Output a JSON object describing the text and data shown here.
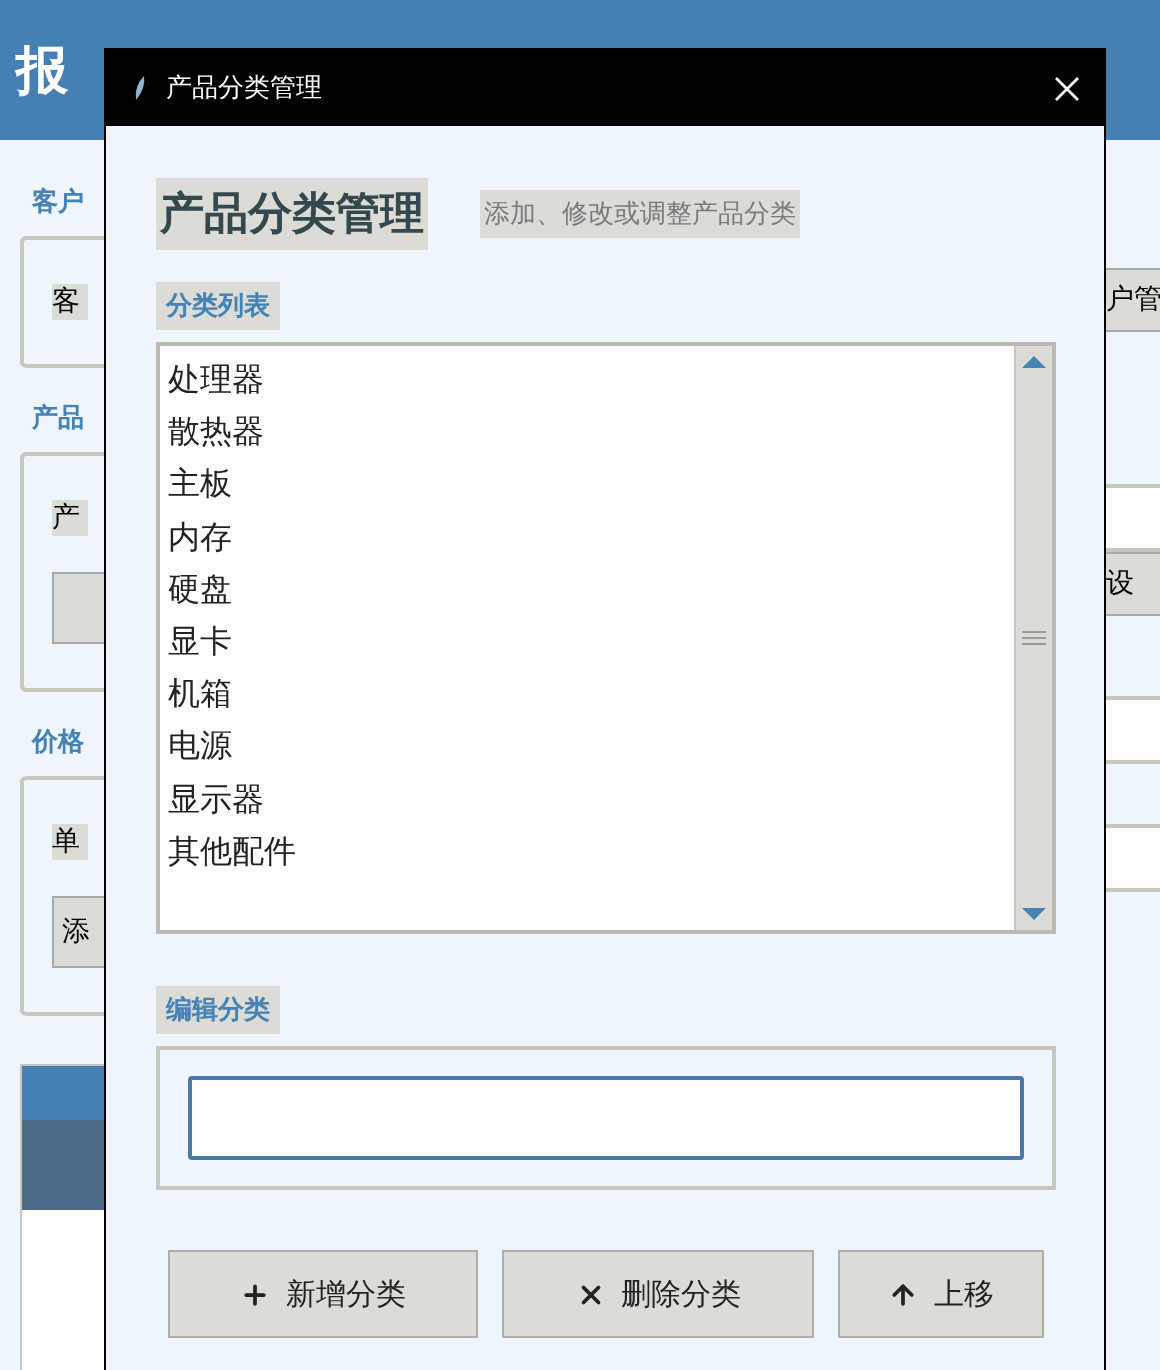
{
  "background": {
    "title": "报",
    "left": [
      {
        "kind": "label",
        "text": "客户"
      },
      {
        "kind": "group",
        "items": [
          {
            "kind": "tag",
            "text": "客"
          }
        ]
      },
      {
        "kind": "label",
        "text": "产品"
      },
      {
        "kind": "group",
        "items": [
          {
            "kind": "tag",
            "text": "产"
          },
          {
            "kind": "button"
          }
        ]
      },
      {
        "kind": "label",
        "text": "价格"
      },
      {
        "kind": "group",
        "items": [
          {
            "kind": "tag",
            "text": "单"
          },
          {
            "kind": "button",
            "text": "添"
          }
        ]
      }
    ],
    "right_buttons": [
      "户管",
      "设"
    ]
  },
  "dialog": {
    "title": "产品分类管理",
    "heading": "产品分类管理",
    "subtitle": "添加、修改或调整产品分类",
    "list_label": "分类列表",
    "categories": [
      {
        "name": "处理器",
        "selected": false
      },
      {
        "name": "散热器",
        "selected": false
      },
      {
        "name": "主板",
        "selected": false
      },
      {
        "name": "内存",
        "selected": false
      },
      {
        "name": "硬盘",
        "selected": false
      },
      {
        "name": "显卡",
        "selected": false
      },
      {
        "name": "机箱",
        "selected": false
      },
      {
        "name": "电源",
        "selected": false
      },
      {
        "name": "显示器",
        "selected": false
      },
      {
        "name": "其他配件",
        "selected": false
      }
    ],
    "edit_label": "编辑分类",
    "buttons": [
      {
        "kind": "add",
        "label": "新增分类"
      },
      {
        "kind": "delete",
        "label": "删除分类"
      },
      {
        "kind": "up",
        "label": "上移"
      }
    ]
  }
}
